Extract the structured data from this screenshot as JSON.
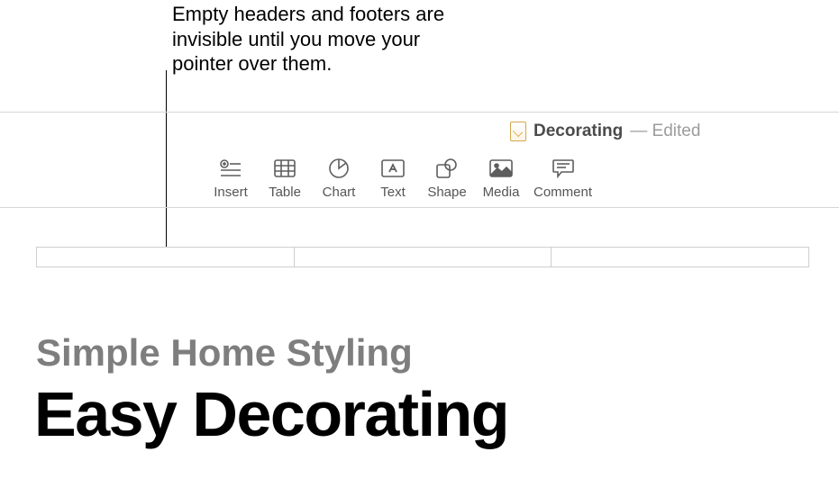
{
  "callout": {
    "text": "Empty headers and footers are invisible until you move your pointer over them."
  },
  "titlebar": {
    "doc_name": "Decorating",
    "separator": " — ",
    "status": "Edited"
  },
  "toolbar": {
    "items": [
      {
        "label": "Insert"
      },
      {
        "label": "Table"
      },
      {
        "label": "Chart"
      },
      {
        "label": "Text"
      },
      {
        "label": "Shape"
      },
      {
        "label": "Media"
      },
      {
        "label": "Comment"
      }
    ]
  },
  "document": {
    "subtitle": "Simple Home Styling",
    "heading": "Easy Decorating"
  }
}
